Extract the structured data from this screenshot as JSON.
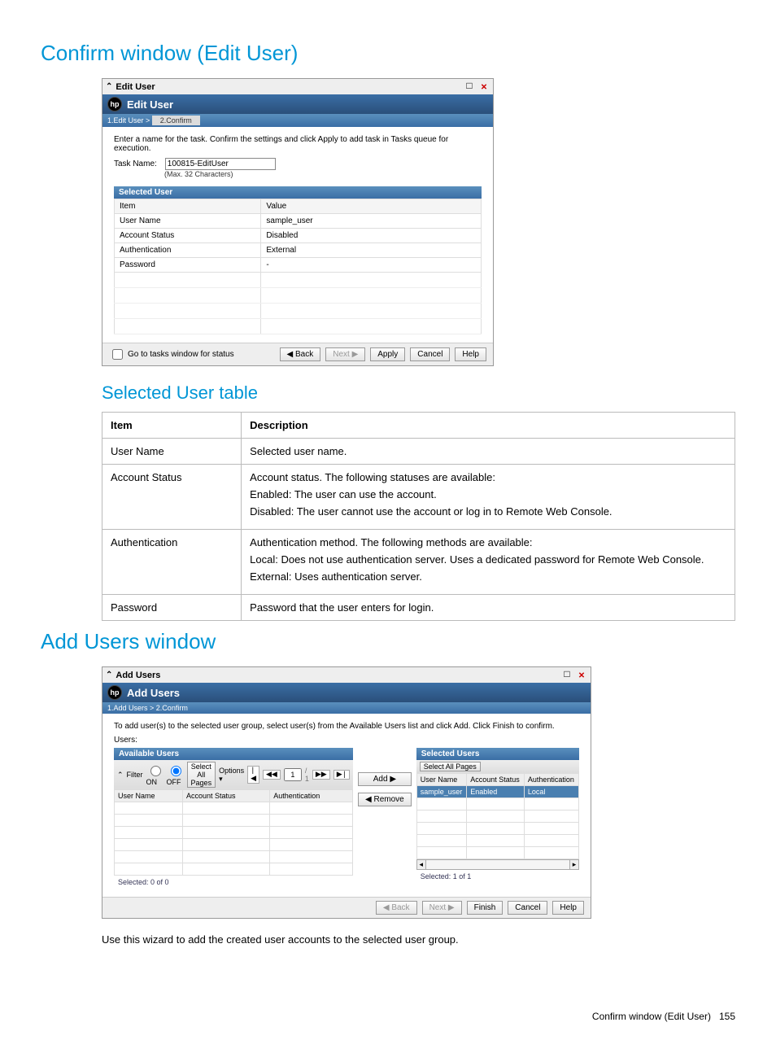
{
  "heading1": "Confirm window (Edit User)",
  "dialog1": {
    "windowTitle": "Edit User",
    "headerTitle": "Edit User",
    "breadcrumb": {
      "step1": "1.Edit User >",
      "step2": "2.Confirm"
    },
    "instruction": "Enter a name for the task. Confirm the settings and click Apply to add task in Tasks queue for execution.",
    "taskNameLabel": "Task Name:",
    "taskNameValue": "100815-EditUser",
    "taskNameHint": "(Max. 32 Characters)",
    "panelTitle": "Selected User",
    "col1": "Item",
    "col2": "Value",
    "rows": [
      {
        "item": "User Name",
        "value": "sample_user"
      },
      {
        "item": "Account Status",
        "value": "Disabled"
      },
      {
        "item": "Authentication",
        "value": "External"
      },
      {
        "item": "Password",
        "value": "-"
      }
    ],
    "goToTasks": "Go to tasks window for status",
    "back": "◀ Back",
    "next": "Next ▶",
    "apply": "Apply",
    "cancel": "Cancel",
    "help": "Help"
  },
  "heading2": "Selected User table",
  "docTable": {
    "h1": "Item",
    "h2": "Description",
    "r1c1": "User Name",
    "r1c2": "Selected user name.",
    "r2c1": "Account Status",
    "r2c2a": "Account status. The following statuses are available:",
    "r2c2b": "Enabled: The user can use the account.",
    "r2c2c": "Disabled: The user cannot use the account or log in to Remote Web Console.",
    "r3c1": "Authentication",
    "r3c2a": "Authentication method. The following methods are available:",
    "r3c2b": "Local: Does not use authentication server. Uses a dedicated password for Remote Web Console.",
    "r3c2c": "External: Uses authentication server.",
    "r4c1": "Password",
    "r4c2": "Password that the user enters for login."
  },
  "heading3": "Add Users window",
  "dialog2": {
    "windowTitle": "Add Users",
    "headerTitle": "Add Users",
    "breadcrumb": {
      "step1": "1.Add Users",
      "step2": "> 2.Confirm"
    },
    "instruction": "To add user(s) to the selected user group, select user(s) from the Available Users list and click Add. Click Finish to confirm.",
    "usersLabel": "Users:",
    "availableTitle": "Available Users",
    "selectedTitle": "Selected Users",
    "filterLabel": "Filter",
    "on": "ON",
    "off": "OFF",
    "selectAll": "Select All Pages",
    "options": "Options ▾",
    "pageCurrent": "1",
    "pageSep": "/ 1",
    "colUser": "User Name",
    "colAcct": "Account Status",
    "colAuth": "Authentication",
    "colAcctShort": "Account Status",
    "selectedRow": {
      "user": "sample_user",
      "acct": "Enabled",
      "auth": "Local"
    },
    "add": "Add ▶",
    "remove": "◀ Remove",
    "selLeft": "Selected: 0   of 0",
    "selRight": "Selected: 1   of 1",
    "back": "◀ Back",
    "next": "Next ▶",
    "finish": "Finish",
    "cancel": "Cancel",
    "help": "Help"
  },
  "paragraph": "Use this wizard to add the created user accounts to the selected user group.",
  "footer": {
    "text": "Confirm window (Edit User)",
    "page": "155"
  }
}
